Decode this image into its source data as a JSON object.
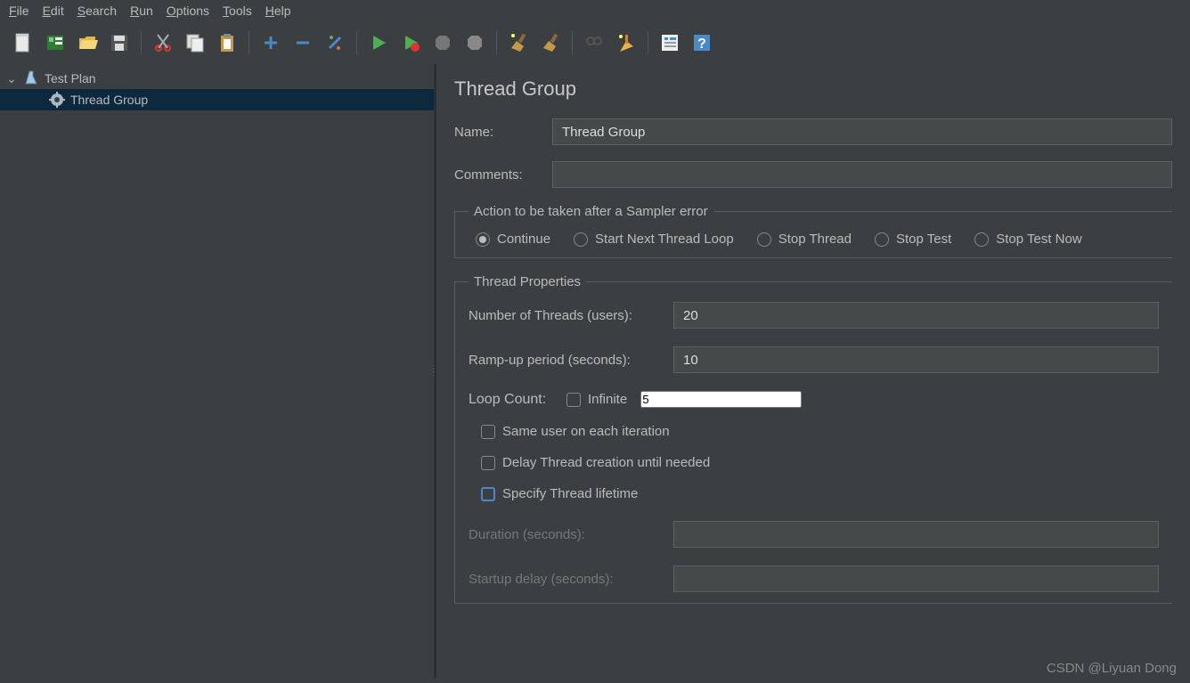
{
  "menubar": [
    "File",
    "Edit",
    "Search",
    "Run",
    "Options",
    "Tools",
    "Help"
  ],
  "tree": {
    "root": "Test Plan",
    "child": "Thread Group"
  },
  "panel": {
    "title": "Thread Group",
    "name_label": "Name:",
    "name_value": "Thread Group",
    "comments_label": "Comments:",
    "comments_value": "",
    "sampler_error_legend": "Action to be taken after a Sampler error",
    "radios": [
      "Continue",
      "Start Next Thread Loop",
      "Stop Thread",
      "Stop Test",
      "Stop Test Now"
    ],
    "radio_selected": 0,
    "thread_props_legend": "Thread Properties",
    "threads_label": "Number of Threads (users):",
    "threads_value": "20",
    "ramp_label": "Ramp-up period (seconds):",
    "ramp_value": "10",
    "loop_label": "Loop Count:",
    "infinite_label": "Infinite",
    "loop_value": "5",
    "same_user_label": "Same user on each iteration",
    "delay_label": "Delay Thread creation until needed",
    "lifetime_label": "Specify Thread lifetime",
    "duration_label": "Duration (seconds):",
    "startup_label": "Startup delay (seconds):"
  },
  "watermark": "CSDN @Liyuan Dong"
}
